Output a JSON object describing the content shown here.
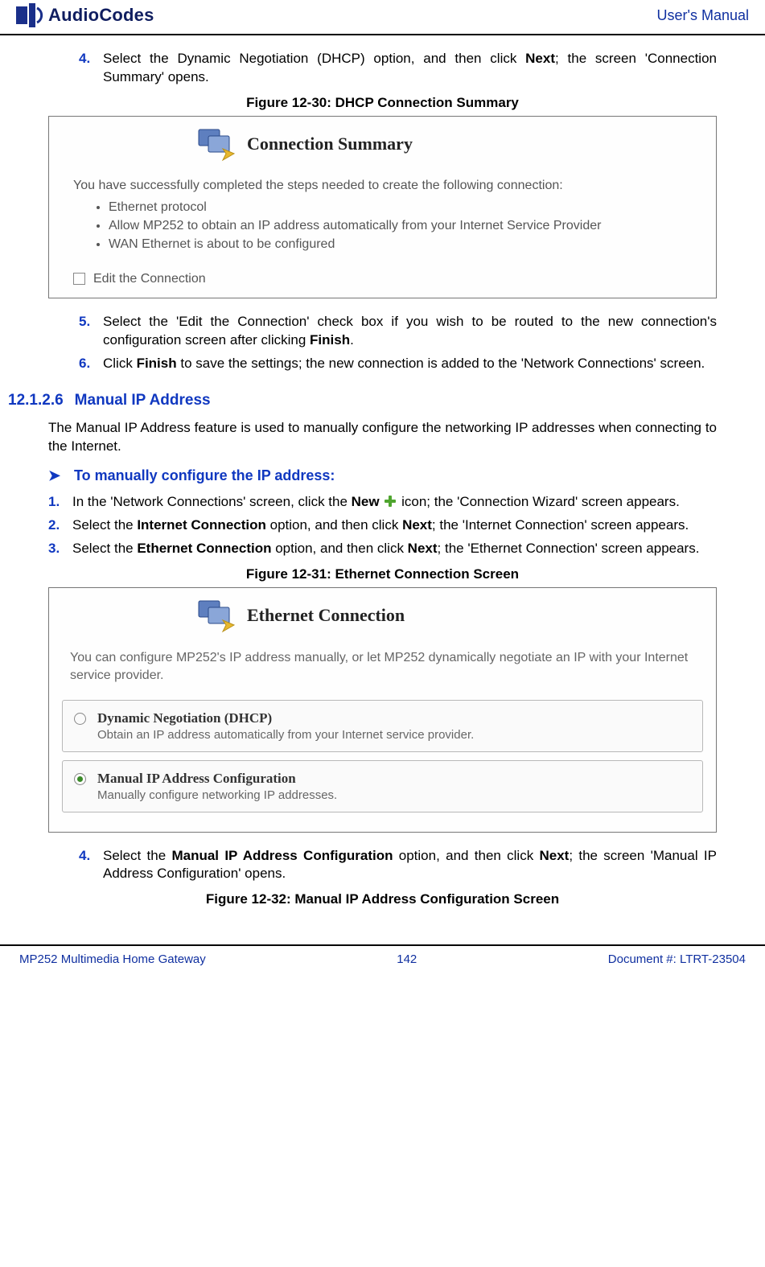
{
  "header": {
    "brand": "AudioCodes",
    "right": "User's Manual"
  },
  "step4": {
    "num": "4.",
    "text_a": "Select the Dynamic Negotiation (DHCP) option, and then click ",
    "bold_a": "Next",
    "text_b": "; the screen 'Connection Summary' opens."
  },
  "fig30": {
    "caption": "Figure 12-30: DHCP Connection Summary",
    "title": "Connection Summary",
    "lead": "You have successfully completed the steps needed to create the following connection:",
    "bullets": {
      "b0": "Ethernet protocol",
      "b1": "Allow MP252 to obtain an IP address automatically from your Internet Service Provider",
      "b2": "WAN Ethernet is about to be configured"
    },
    "edit": "Edit the Connection"
  },
  "step5": {
    "num": "5.",
    "text_a": "Select the 'Edit the Connection' check box if you wish to be routed to the new connection's configuration screen after clicking ",
    "bold_a": "Finish",
    "text_b": "."
  },
  "step6": {
    "num": "6.",
    "text_a": "Click ",
    "bold_a": "Finish",
    "text_b": " to save the settings; the new connection is added to the 'Network Connections' screen."
  },
  "section": {
    "num": "12.1.2.6",
    "title": "Manual IP Address",
    "para": "The Manual IP Address feature is used to manually configure the networking IP addresses when connecting to the Internet."
  },
  "proc": {
    "title": "To manually configure the IP address:"
  },
  "pstep1": {
    "num": "1.",
    "text_a": "In the 'Network Connections' screen, click the ",
    "bold_a": "New",
    "text_b": " icon; the 'Connection Wizard' screen appears."
  },
  "pstep2": {
    "num": "2.",
    "text_a": "Select the ",
    "bold_a": "Internet Connection",
    "text_b": " option, and then click ",
    "bold_b": "Next",
    "text_c": "; the 'Internet Connection' screen appears."
  },
  "pstep3": {
    "num": "3.",
    "text_a": "Select the ",
    "bold_a": "Ethernet Connection",
    "text_b": " option, and then click ",
    "bold_b": "Next",
    "text_c": "; the 'Ethernet Connection' screen appears."
  },
  "fig31": {
    "caption": "Figure 12-31: Ethernet Connection Screen",
    "title": "Ethernet Connection",
    "desc": "You can configure MP252's IP address manually, or let MP252 dynamically negotiate an IP with your Internet service provider.",
    "opt1": {
      "title": "Dynamic Negotiation (DHCP)",
      "sub": "Obtain an IP address automatically from your Internet service provider."
    },
    "opt2": {
      "title": "Manual IP Address Configuration",
      "sub": "Manually configure networking IP addresses."
    }
  },
  "pstep4": {
    "num": "4.",
    "text_a": "Select the ",
    "bold_a": "Manual IP Address Configuration",
    "text_b": " option, and then click ",
    "bold_b": "Next",
    "text_c": "; the screen 'Manual IP Address Configuration' opens."
  },
  "fig32": {
    "caption": "Figure 12-32: Manual IP Address Configuration Screen"
  },
  "footer": {
    "left": "MP252 Multimedia Home Gateway",
    "center": "142",
    "right": "Document #: LTRT-23504"
  }
}
